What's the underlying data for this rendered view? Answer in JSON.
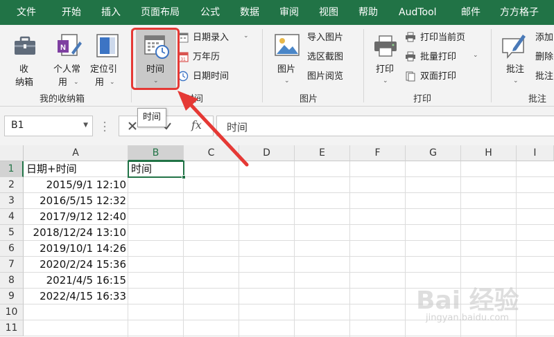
{
  "menu": {
    "tabs": [
      "文件",
      "开始",
      "插入",
      "页面布局",
      "公式",
      "数据",
      "审阅",
      "视图",
      "帮助",
      "AudTool",
      "邮件",
      "方方格子"
    ]
  },
  "ribbon": {
    "box": {
      "label1": "收",
      "label2": "纳箱",
      "icon": "briefcase-icon"
    },
    "personal": {
      "label1": "个人常",
      "label2": "用",
      "icon": "personal-notebook-icon"
    },
    "locate": {
      "label1": "定位引",
      "label2": "用",
      "icon": "locate-reference-icon"
    },
    "group_box": "我的收纳箱",
    "time": {
      "label": "时间",
      "icon": "calendar-clock-icon"
    },
    "date_entry": "日期录入",
    "calendar": "万年历",
    "datetime": "日期时间",
    "group_time": "时间",
    "image": {
      "label": "图片",
      "icon": "picture-icon"
    },
    "import_image": "导入图片",
    "select_capture": "选区截图",
    "image_browse": "图片阅览",
    "group_image": "图片",
    "print": {
      "label": "打印",
      "icon": "printer-icon"
    },
    "print_current": "打印当前页",
    "batch_print": "批量打印",
    "duplex_print": "双面打印",
    "group_print": "打印",
    "comment": {
      "label": "批注",
      "icon": "comment-pen-icon"
    },
    "add": "添加",
    "delete": "删除",
    "comment2": "批注",
    "group_comment": "批注"
  },
  "formula_bar": {
    "name_box": "B1",
    "fx": "fx",
    "formula": "时间"
  },
  "tooltip": "时间",
  "sheet": {
    "columns": [
      "A",
      "B",
      "C",
      "D",
      "E",
      "F",
      "G",
      "H",
      "I"
    ],
    "rows": [
      "1",
      "2",
      "3",
      "4",
      "5",
      "6",
      "7",
      "8",
      "9",
      "10",
      "11"
    ],
    "a_values": [
      "日期+时间",
      "2015/9/1 12:10",
      "2016/5/15 12:32",
      "2017/9/12 12:40",
      "2018/12/24 13:10",
      "2019/10/1 14:26",
      "2020/2/24 15:36",
      "2021/4/5 16:15",
      "2022/4/15 16:33"
    ],
    "b1": "时间"
  },
  "colors": {
    "accent": "#217346",
    "highlight": "#e53935"
  },
  "watermark": {
    "main": "Bai 经验",
    "sub": "jingyan.baidu.com"
  }
}
